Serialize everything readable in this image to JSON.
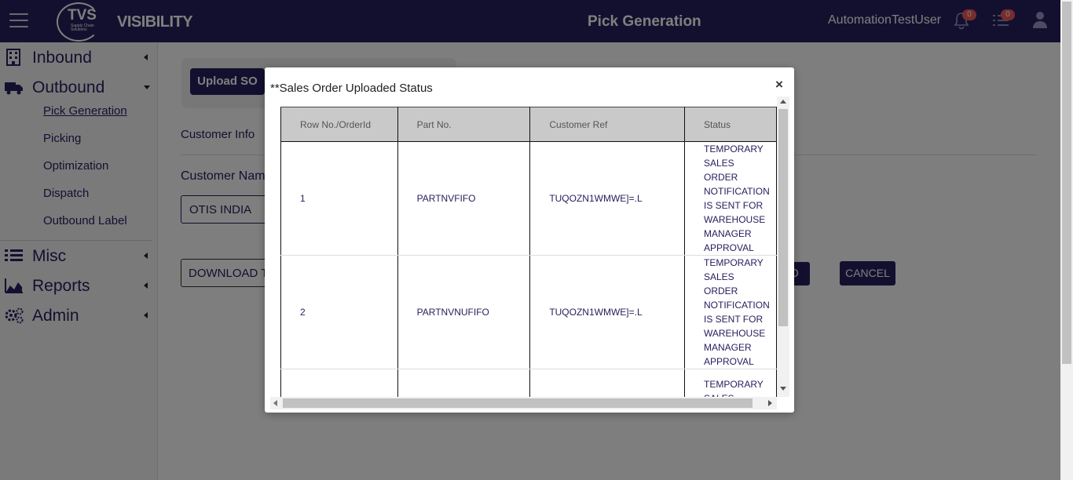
{
  "header": {
    "logo_text": "TVS",
    "logo_sub": "Supply Chain Solutions",
    "brand": "VISIBILITY",
    "page_title": "Pick Generation",
    "username": "AutomationTestUser",
    "notifications_count": "0",
    "tasks_count": "0"
  },
  "sidebar": {
    "inbound": "Inbound",
    "outbound": "Outbound",
    "outbound_items": [
      "Pick Generation",
      "Picking",
      "Optimization",
      "Dispatch",
      "Outbound Label"
    ],
    "misc": "Misc",
    "reports": "Reports",
    "admin": "Admin"
  },
  "main": {
    "upload_button": "Upload SO",
    "customer_info": "Customer Info",
    "customer_name_label": "Customer Nam",
    "customer_name_value": "OTIS INDIA",
    "download_button": "DOWNLOAD TE",
    "go_button": "O",
    "cancel_button": "CANCEL"
  },
  "modal": {
    "title": "**Sales Order Uploaded Status",
    "close": "×",
    "columns": [
      "Row No./OrderId",
      "Part No.",
      "Customer Ref",
      "Status"
    ],
    "rows": [
      {
        "row": "1",
        "part": "PARTNVFIFO",
        "ref": "TUQOZN1WMWE]=.L",
        "status": "TEMPORARY SALES ORDER NOTIFICATION IS SENT FOR WAREHOUSE MANAGER APPROVAL"
      },
      {
        "row": "2",
        "part": "PARTNVNUFIFO",
        "ref": "TUQOZN1WMWE]=.L",
        "status": "TEMPORARY SALES ORDER NOTIFICATION IS SENT FOR WAREHOUSE MANAGER APPROVAL"
      },
      {
        "row": "",
        "part": "",
        "ref": "",
        "status": "TEMPORARY SALES ORDER NOTIFICATION"
      }
    ]
  },
  "colors": {
    "primary": "#27215e",
    "badge": "#f05a5a",
    "header_bg": "#c9c9c9"
  }
}
